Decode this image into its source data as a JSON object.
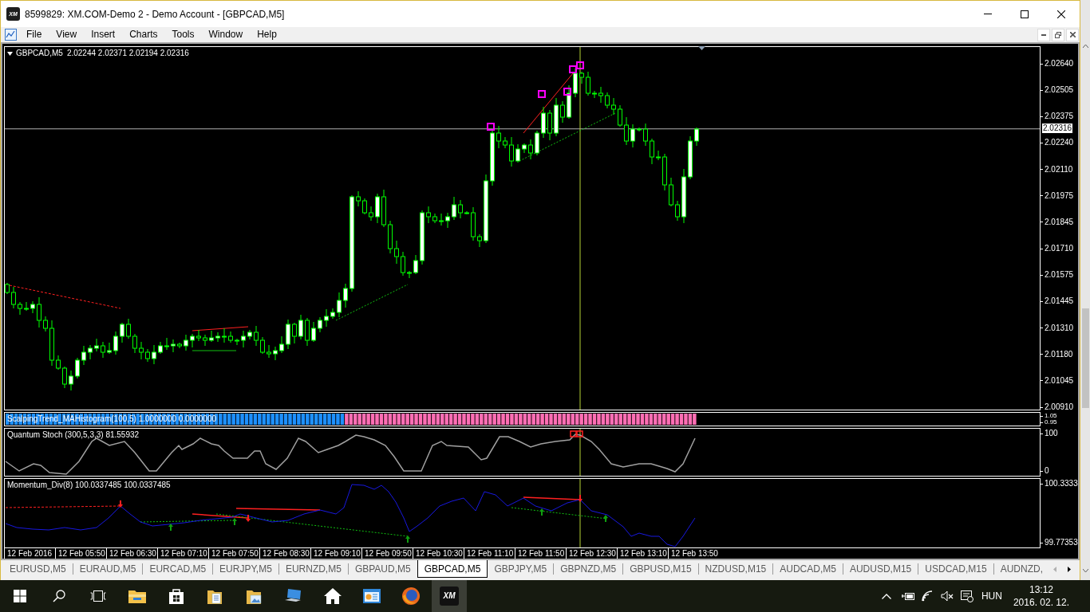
{
  "window": {
    "logo": "XM",
    "title": "8599829: XM.COM-Demo 2 - Demo Account - [GBPCAD,M5]"
  },
  "menu": [
    "File",
    "View",
    "Insert",
    "Charts",
    "Tools",
    "Window",
    "Help"
  ],
  "chart": {
    "symbol": "GBPCAD,M5",
    "ohlc": "2.02244 2.02371 2.02194 2.02316",
    "price_ticks": [
      "2.02640",
      "2.02505",
      "2.02375",
      "2.02240",
      "2.02110",
      "2.01975",
      "2.01845",
      "2.01710",
      "2.01575",
      "2.01445",
      "2.01310",
      "2.01180",
      "2.01045",
      "2.00910"
    ],
    "current_price": "2.02316",
    "indicators": [
      {
        "kind": "histogram",
        "label": "ScalpingTrend_MAHistogram(100,5) 1.0000000 0.0000000",
        "axis": [
          "1.05",
          "0.95"
        ]
      },
      {
        "kind": "stochastic",
        "label": "Quantum Stoch (300,5,3,3) 81.55932",
        "axis": [
          "100",
          "0"
        ]
      },
      {
        "kind": "momentum",
        "label": "Momentum_Div(8) 100.0337485 100.0337485",
        "axis": [
          "100.3333",
          "99.77353"
        ]
      }
    ],
    "time_labels": [
      "12 Feb 2016",
      "12 Feb 05:50",
      "12 Feb 06:30",
      "12 Feb 07:10",
      "12 Feb 07:50",
      "12 Feb 08:30",
      "12 Feb 09:10",
      "12 Feb 09:50",
      "12 Feb 10:30",
      "12 Feb 11:10",
      "12 Feb 11:50",
      "12 Feb 12:30",
      "12 Feb 13:10",
      "12 Feb 13:50"
    ]
  },
  "tabs": [
    {
      "label": "EURUSD,M5",
      "selected": false
    },
    {
      "label": "EURAUD,M5",
      "selected": false
    },
    {
      "label": "EURCAD,M5",
      "selected": false
    },
    {
      "label": "EURJPY,M5",
      "selected": false
    },
    {
      "label": "EURNZD,M5",
      "selected": false
    },
    {
      "label": "GBPAUD,M5",
      "selected": false
    },
    {
      "label": "GBPCAD,M5",
      "selected": true
    },
    {
      "label": "GBPJPY,M5",
      "selected": false
    },
    {
      "label": "GBPNZD,M5",
      "selected": false
    },
    {
      "label": "GBPUSD,M15",
      "selected": false
    },
    {
      "label": "NZDUSD,M15",
      "selected": false
    },
    {
      "label": "AUDCAD,M5",
      "selected": false
    },
    {
      "label": "AUDUSD,M15",
      "selected": false
    },
    {
      "label": "USDCAD,M15",
      "selected": false
    },
    {
      "label": "AUDNZD,",
      "selected": false
    }
  ],
  "taskbar": {
    "app_logo": "XM",
    "language": "HUN",
    "time": "13:12",
    "date": "2016. 02. 12."
  }
}
